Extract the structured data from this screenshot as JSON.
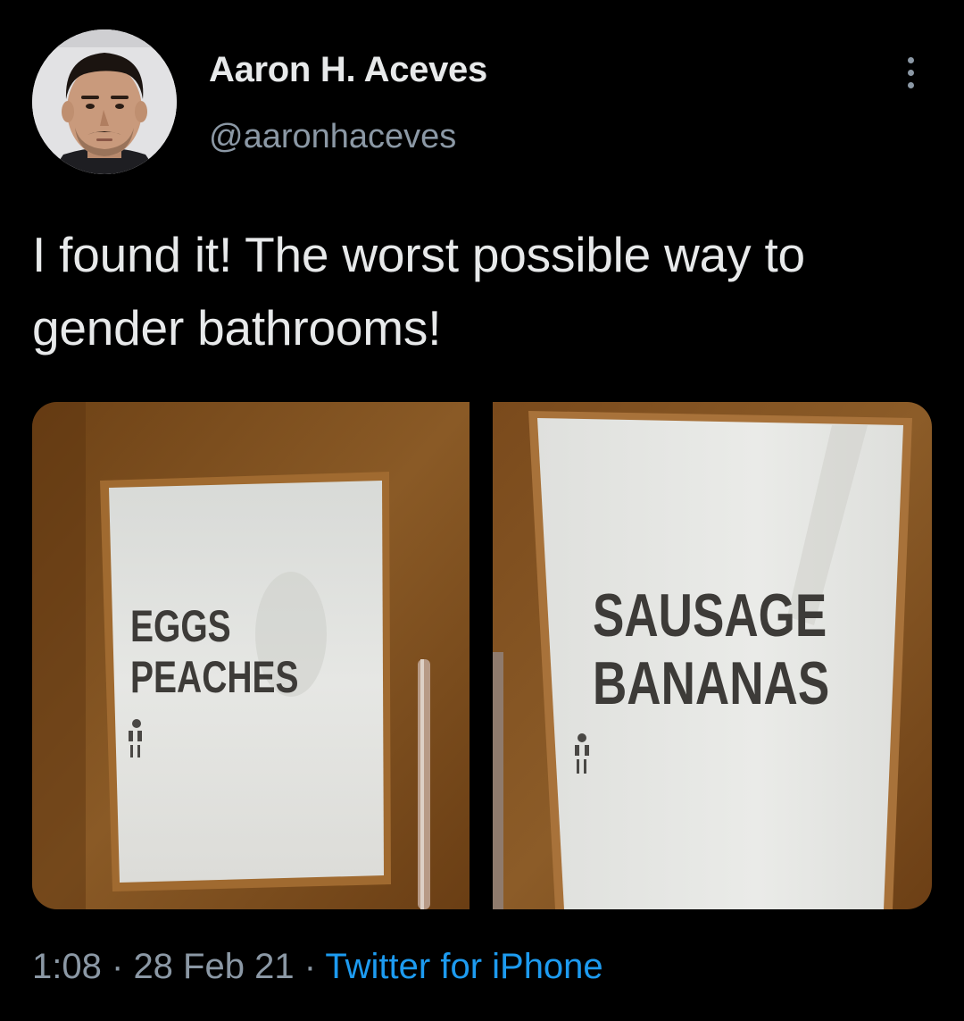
{
  "author": {
    "name": "Aaron H. Aceves",
    "handle": "@aaronhaceves"
  },
  "tweet": {
    "text": "I found it! The worst possible way to gender bathrooms!"
  },
  "media": {
    "left_sign": {
      "line1": "EGGS",
      "line2": "PEACHES"
    },
    "right_sign": {
      "line1": "SAUSAGE",
      "line2": "BANANAS"
    }
  },
  "meta": {
    "time": "1:08",
    "separator1": "·",
    "date": "28 Feb 21",
    "separator2": "·",
    "source": "Twitter for iPhone"
  },
  "icons": {
    "more": "more-options-icon"
  },
  "colors": {
    "background": "#000000",
    "text": "#e7e9ea",
    "secondary": "#8b98a5",
    "link": "#1d9bf0"
  }
}
